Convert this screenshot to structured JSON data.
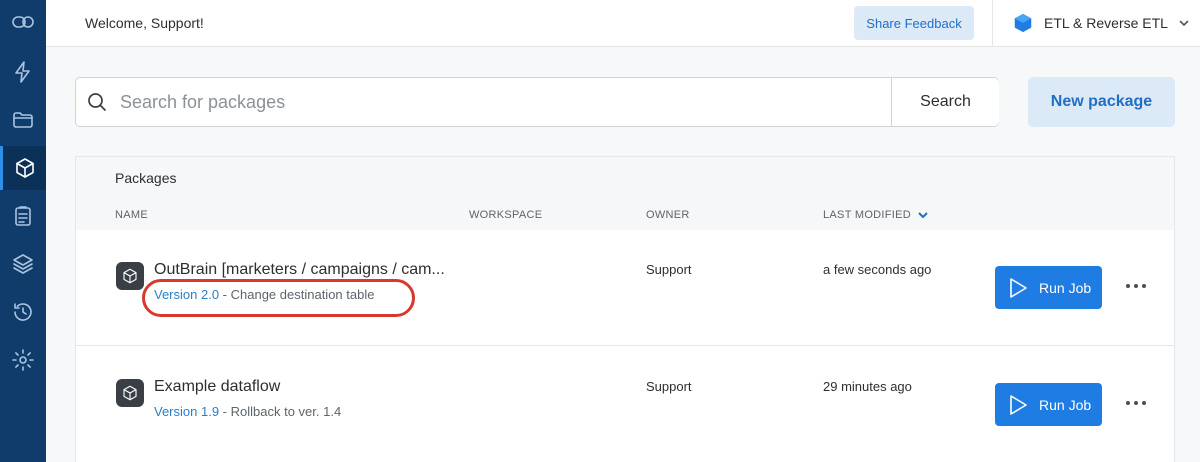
{
  "header": {
    "welcome": "Welcome, Support!",
    "share_feedback": "Share Feedback",
    "workspace_name": "ETL & Reverse ETL",
    "accent_color": "#1f6fc9"
  },
  "sidebar": {
    "items": [
      {
        "icon": "logo-icon"
      },
      {
        "icon": "lightning-icon"
      },
      {
        "icon": "folder-icon"
      },
      {
        "icon": "package-icon",
        "active": true
      },
      {
        "icon": "clipboard-icon"
      },
      {
        "icon": "layers-icon"
      },
      {
        "icon": "history-icon"
      },
      {
        "icon": "gear-icon"
      }
    ],
    "background": "#0f3c6b"
  },
  "search": {
    "placeholder": "Search for packages",
    "value": "",
    "button_label": "Search"
  },
  "actions": {
    "new_package": "New package"
  },
  "packages": {
    "title": "Packages",
    "columns": {
      "name": "NAME",
      "workspace": "WORKSPACE",
      "owner": "OWNER",
      "last_modified": "LAST MODIFIED"
    },
    "rows": [
      {
        "name": "OutBrain [marketers / campaigns / cam...",
        "version": "Version 2.0",
        "description": "Change destination table",
        "workspace": "",
        "owner": "Support",
        "last_modified": "a few seconds ago",
        "run_label": "Run Job"
      },
      {
        "name": "Example dataflow",
        "version": "Version 1.9",
        "description": "Rollback to ver. 1.4",
        "workspace": "",
        "owner": "Support",
        "last_modified": "29 minutes ago",
        "run_label": "Run Job"
      }
    ]
  },
  "colors": {
    "run_button": "#1f7ce3",
    "version_link": "#2a7fc9",
    "highlight": "#d63a2f"
  }
}
